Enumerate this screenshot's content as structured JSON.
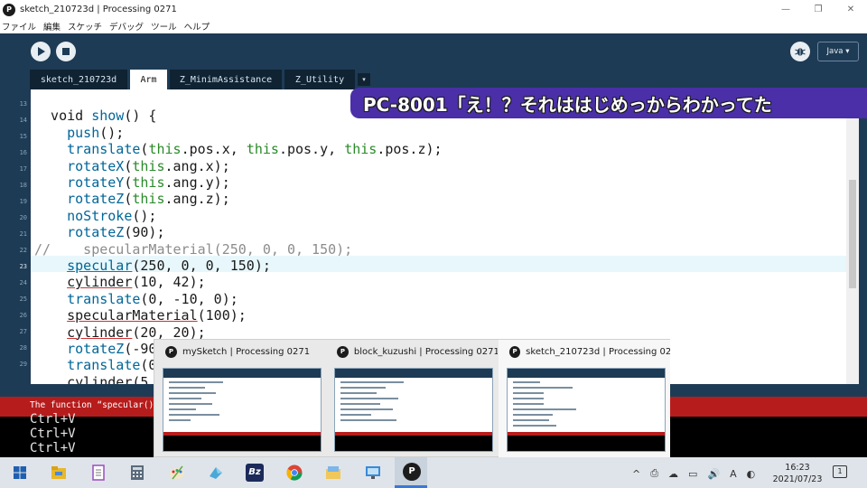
{
  "window": {
    "title": "sketch_210723d | Processing 0271",
    "app_icon_glyph": "P",
    "controls": [
      "—",
      "❐",
      "✕"
    ]
  },
  "menubar": {
    "items": [
      "ファイル",
      "編集",
      "スケッチ",
      "デバッグ",
      "ツール",
      "ヘルプ"
    ]
  },
  "toolbar": {
    "debug_icon": "debug-icon",
    "mode": "Java ▾"
  },
  "tabs": [
    {
      "label": "sketch_210723d",
      "active": false
    },
    {
      "label": "Arm",
      "active": true
    },
    {
      "label": "Z_MinimAssistance",
      "active": false
    },
    {
      "label": "Z_Utility",
      "active": false
    }
  ],
  "tab_more": "▾",
  "editor": {
    "line_numbers": [
      "13",
      "14",
      "15",
      "16",
      "17",
      "18",
      "19",
      "20",
      "21",
      "22",
      "23",
      "24",
      "25",
      "26",
      "27",
      "28",
      "29"
    ],
    "current_line": "23"
  },
  "overlay_caption": "PC-8001「え！？それははじめっからわかってた",
  "status": {
    "message": "The function “specular()” ex"
  },
  "console": {
    "lines": [
      "Ctrl+V",
      "Ctrl+V",
      "Ctrl+V"
    ]
  },
  "previews": [
    {
      "title": "mySketch | Processing 0271",
      "active": false
    },
    {
      "title": "block_kuzushi | Processing 0271",
      "active": false
    },
    {
      "title": "sketch_210723d | Processing 02...",
      "active": true
    }
  ],
  "taskbar": {
    "icons": [
      "windows-start-icon",
      "file-explorer-icon",
      "notepad-icon",
      "calculator-icon",
      "paint-icon",
      "paint3d-icon",
      "bz-editor-icon",
      "chrome-icon",
      "folder-tool-icon",
      "remote-desktop-icon",
      "processing-icon"
    ],
    "bz_label": "Bz",
    "tray_glyphs": [
      "^",
      "⎙",
      "☁",
      "▭",
      "🔊",
      "A",
      "◐"
    ],
    "time": "16:23",
    "date": "2021/07/23",
    "notification_count": "1"
  },
  "colors": {
    "ide_background": "#1e3b55",
    "error_bar": "#b71c1c",
    "overlay_background": "#4a2fa8",
    "keyword_green": "#2a8a2a",
    "function_blue": "#006699"
  }
}
